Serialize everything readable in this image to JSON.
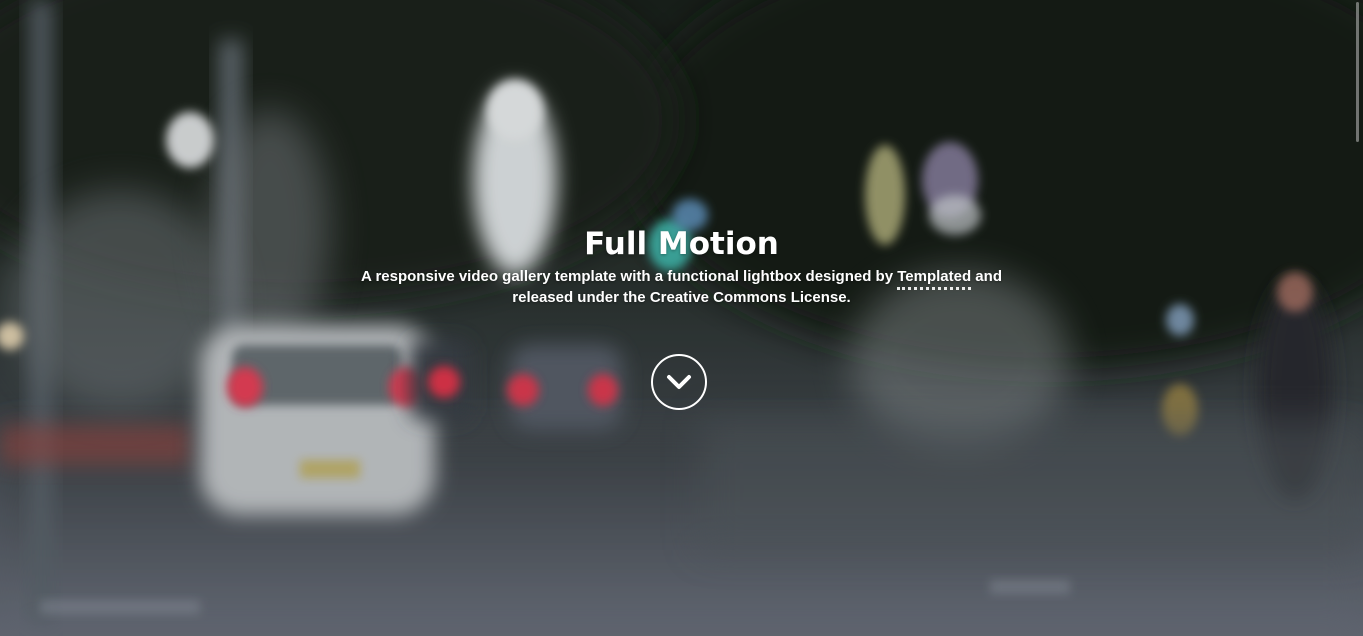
{
  "banner": {
    "title": "Full Motion",
    "subtitle_before": "A responsive video gallery template with a functional lightbox designed by ",
    "subtitle_link": "Templated",
    "subtitle_after": " and released under the Creative Commons License."
  },
  "more_button": {
    "icon": "chevron-down-icon"
  },
  "colors": {
    "text": "#ffffff",
    "background": "#1d2320"
  }
}
